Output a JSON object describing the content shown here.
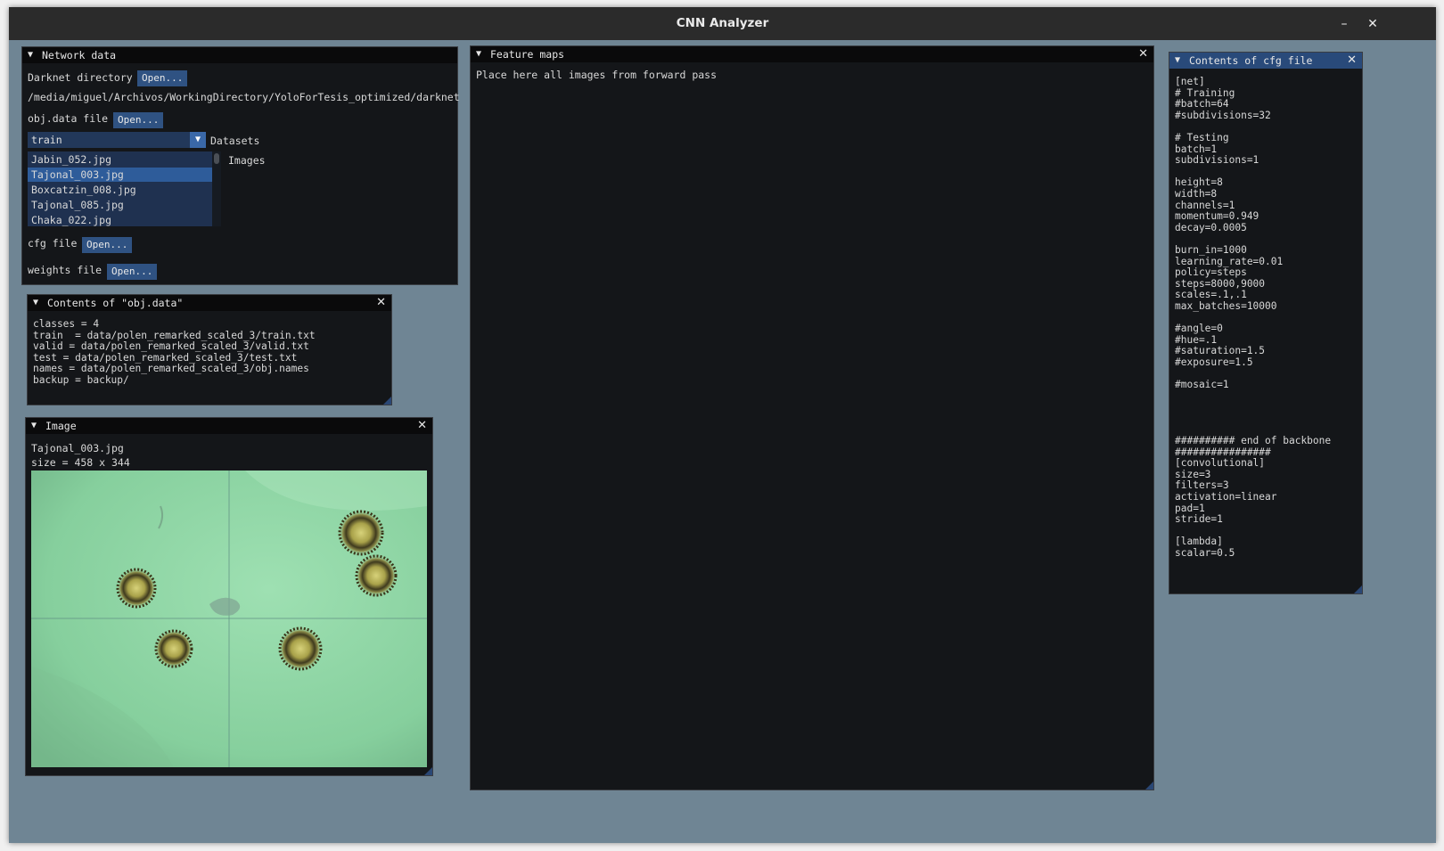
{
  "app": {
    "title": "CNN Analyzer",
    "minimize_glyph": "–",
    "close_glyph": "✕"
  },
  "network_data": {
    "title": "Network data",
    "darknet_label": "Darknet directory",
    "darknet_button": "Open...",
    "darknet_path": "/media/miguel/Archivos/WorkingDirectory/YoloForTesis_optimized/darknet",
    "objdata_label": "obj.data file",
    "objdata_button": "Open...",
    "dataset_selected": "train",
    "datasets_label": "Datasets",
    "images_label": "Images",
    "images": [
      "Jabin_052.jpg",
      "Tajonal_003.jpg",
      "Boxcatzin_008.jpg",
      "Tajonal_085.jpg",
      "Chaka_022.jpg"
    ],
    "selected_image_index": 1,
    "cfg_label": "cfg file",
    "cfg_button": "Open...",
    "weights_label": "weights file",
    "weights_button": "Open..."
  },
  "obj_data_window": {
    "title": "Contents of \"obj.data\"",
    "content": "classes = 4\ntrain  = data/polen_remarked_scaled_3/train.txt\nvalid = data/polen_remarked_scaled_3/valid.txt\ntest = data/polen_remarked_scaled_3/test.txt\nnames = data/polen_remarked_scaled_3/obj.names\nbackup = backup/"
  },
  "image_window": {
    "title": "Image",
    "filename": "Tajonal_003.jpg",
    "size_text": "size = 458 x 344"
  },
  "feature_maps": {
    "title": "Feature maps",
    "placeholder": "Place here all images from forward pass"
  },
  "cfg_window": {
    "title": "Contents of cfg file",
    "content": "[net]\n# Training\n#batch=64\n#subdivisions=32\n\n# Testing\nbatch=1\nsubdivisions=1\n\nheight=8\nwidth=8\nchannels=1\nmomentum=0.949\ndecay=0.0005\n\nburn_in=1000\nlearning_rate=0.01\npolicy=steps\nsteps=8000,9000\nscales=.1,.1\nmax_batches=10000\n\n#angle=0\n#hue=.1\n#saturation=1.5\n#exposure=1.5\n\n#mosaic=1\n\n\n\n\n########## end of backbone\n################\n[convolutional]\nsize=3\nfilters=3\nactivation=linear\npad=1\nstride=1\n\n[lambda]\nscalar=0.5"
  },
  "icons": {
    "collapse": "triangle-down-icon",
    "close": "close-icon",
    "combo_arrow": "chevron-down-icon"
  },
  "colors": {
    "background": "#6f8594",
    "window_bg": "#141619",
    "title_active": "#294a7a",
    "button": "#2f5282"
  }
}
